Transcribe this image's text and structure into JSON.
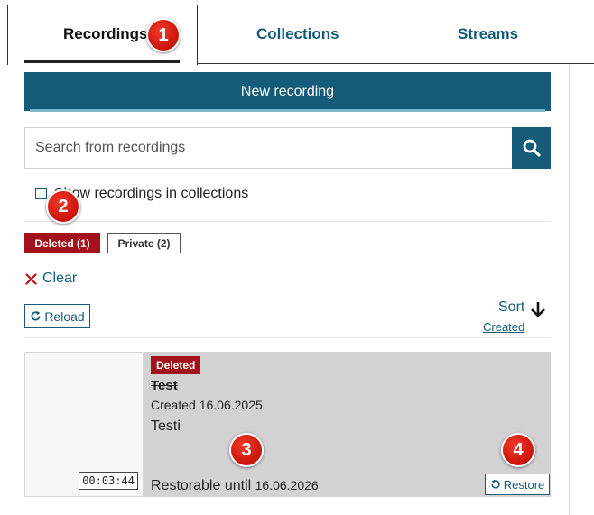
{
  "tabs": [
    {
      "label": "Recordings",
      "active": true
    },
    {
      "label": "Collections",
      "active": false
    },
    {
      "label": "Streams",
      "active": false
    }
  ],
  "markers": [
    "1",
    "2",
    "3",
    "4"
  ],
  "toolbar": {
    "new_recording_label": "New recording"
  },
  "search": {
    "placeholder": "Search from recordings",
    "icon": "magnifier-icon"
  },
  "filters": {
    "show_in_collections_label": "Show recordings in collections",
    "show_in_collections_checked": false,
    "chips": [
      {
        "label": "Deleted (1)",
        "active": true
      },
      {
        "label": "Private (2)",
        "active": false
      }
    ],
    "clear_label": "Clear"
  },
  "actions": {
    "reload_label": "Reload",
    "sort_label": "Sort",
    "sort_by": "Created",
    "sort_direction": "descending"
  },
  "recordings": [
    {
      "status_badge": "Deleted",
      "title": "Test",
      "created": "Created 16.06.2025",
      "description": "Testi",
      "restorable_label": "Restorable until",
      "restorable_date": "16.06.2026",
      "duration": "00:03:44",
      "restore_label": "Restore"
    }
  ],
  "colors": {
    "primary": "#145c7a",
    "danger": "#a3111b",
    "marker": "#d81e10",
    "card_bg": "#d2d2d2"
  }
}
